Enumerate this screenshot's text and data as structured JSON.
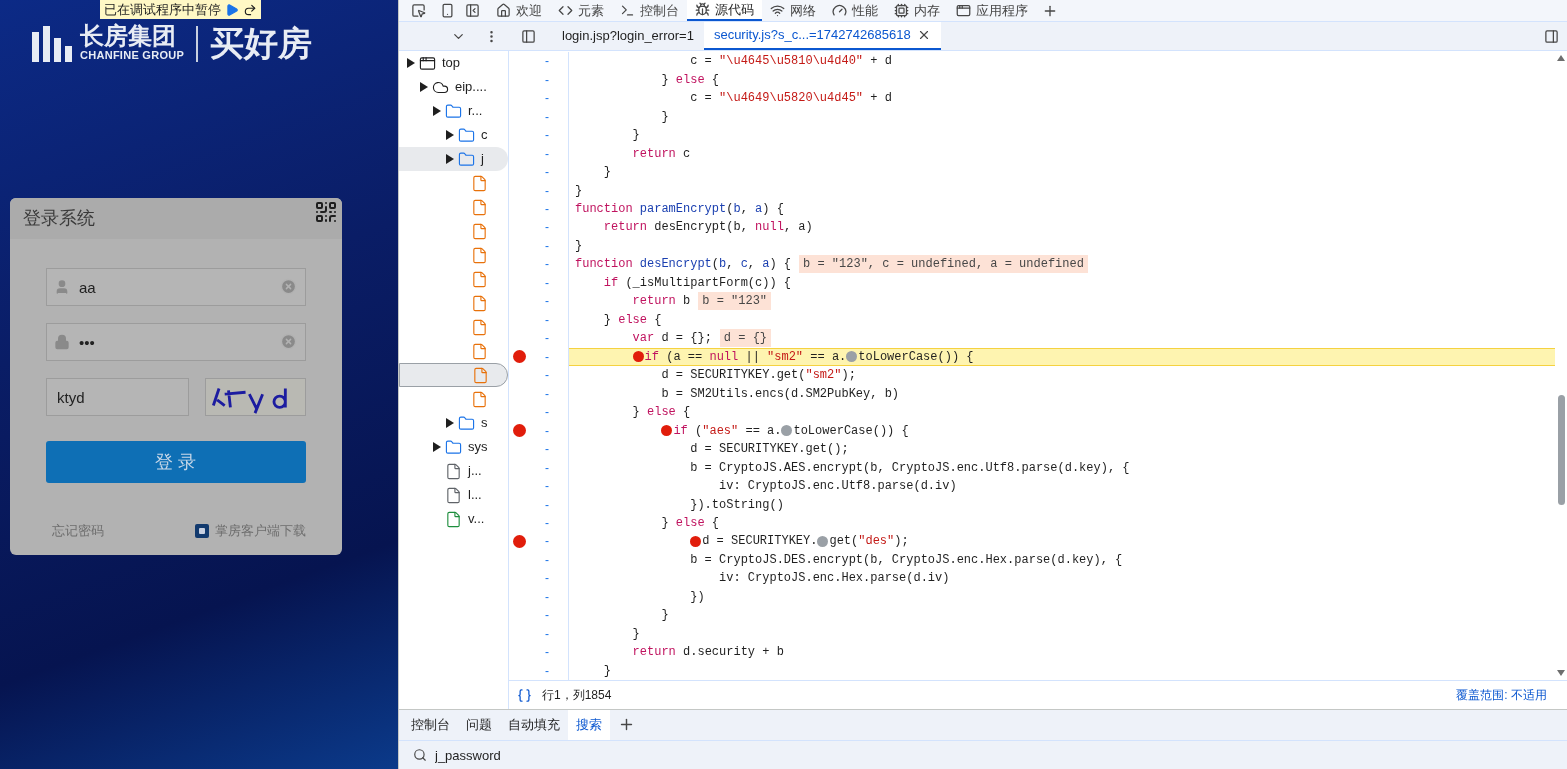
{
  "page": {
    "logo": {
      "name": "长房集团",
      "subtitle": "CHANFINE GROUP",
      "slogan": "买好房"
    },
    "debug_banner": {
      "text": "已在调试程序中暂停"
    },
    "login": {
      "title": "登录系统",
      "username": "aa",
      "password": "•••",
      "captcha": "ktyd",
      "submit": "登 录",
      "links": [
        "忘记密码",
        "掌房客户端下载"
      ]
    }
  },
  "devtools": {
    "tabs": [
      {
        "label": "欢迎",
        "selected": false
      },
      {
        "label": "元素",
        "selected": false
      },
      {
        "label": "控制台",
        "selected": false
      },
      {
        "label": "源代码",
        "selected": true
      },
      {
        "label": "网络",
        "selected": false
      },
      {
        "label": "性能",
        "selected": false
      },
      {
        "label": "内存",
        "selected": false
      },
      {
        "label": "应用程序",
        "selected": false
      }
    ],
    "file_tabs": [
      {
        "label": "login.jsp?login_error=1",
        "selected": false
      },
      {
        "label": "security.js?s_c...=1742742685618",
        "selected": true
      }
    ],
    "tree": [
      {
        "label": "top",
        "kind": "frame",
        "selected": false,
        "children": [
          {
            "label": "eip....",
            "kind": "cloud",
            "selected": false,
            "children": [
              {
                "label": "r...",
                "kind": "folder",
                "selected": false,
                "children": [
                  {
                    "label": "c",
                    "kind": "folder",
                    "selected": false
                  },
                  {
                    "label": "j",
                    "kind": "folder",
                    "selected": true,
                    "children": [
                      {
                        "kind": "file",
                        "color": "#e8710a",
                        "selected": false
                      },
                      {
                        "kind": "file",
                        "color": "#e8710a",
                        "selected": false
                      },
                      {
                        "kind": "file",
                        "color": "#e8710a",
                        "selected": false
                      },
                      {
                        "kind": "file",
                        "color": "#e8710a",
                        "selected": false
                      },
                      {
                        "kind": "file",
                        "color": "#e8710a",
                        "selected": false
                      },
                      {
                        "kind": "file",
                        "color": "#e8710a",
                        "selected": false
                      },
                      {
                        "kind": "file",
                        "color": "#e8710a",
                        "selected": false
                      },
                      {
                        "kind": "file",
                        "color": "#e8710a",
                        "selected": false
                      },
                      {
                        "kind": "file",
                        "color": "#e8710a",
                        "selected": true
                      },
                      {
                        "kind": "file",
                        "color": "#e8710a",
                        "selected": false
                      }
                    ]
                  },
                  {
                    "label": "s",
                    "kind": "folder",
                    "selected": false
                  }
                ]
              },
              {
                "label": "sys",
                "kind": "folder",
                "selected": false
              },
              {
                "label": "j...",
                "kind": "file",
                "color": "#5f6368",
                "selected": false
              },
              {
                "label": "l...",
                "kind": "file",
                "color": "#5f6368",
                "selected": false
              },
              {
                "label": "v...",
                "kind": "file",
                "color": "#1e8e3e",
                "selected": false
              }
            ]
          }
        ]
      }
    ],
    "code": {
      "lines": [
        {
          "number": "-",
          "breakpoint": false,
          "paused": false,
          "tokens": [
            {
              "kind": "plain",
              "text": "                c = "
            },
            {
              "kind": "string",
              "text": "\"\\u4645\\u5810\\u4d40\""
            },
            {
              "kind": "plain",
              "text": " + d"
            }
          ]
        },
        {
          "number": "-",
          "breakpoint": false,
          "paused": false,
          "tokens": [
            {
              "kind": "plain",
              "text": "            } "
            },
            {
              "kind": "keyword",
              "text": "else"
            },
            {
              "kind": "plain",
              "text": " {"
            }
          ]
        },
        {
          "number": "-",
          "breakpoint": false,
          "paused": false,
          "tokens": [
            {
              "kind": "plain",
              "text": "                c = "
            },
            {
              "kind": "string",
              "text": "\"\\u4649\\u5820\\u4d45\""
            },
            {
              "kind": "plain",
              "text": " + d"
            }
          ]
        },
        {
          "number": "-",
          "breakpoint": false,
          "paused": false,
          "tokens": [
            {
              "kind": "plain",
              "text": "            }"
            }
          ]
        },
        {
          "number": "-",
          "breakpoint": false,
          "paused": false,
          "tokens": [
            {
              "kind": "plain",
              "text": "        }"
            }
          ]
        },
        {
          "number": "-",
          "breakpoint": false,
          "paused": false,
          "tokens": [
            {
              "kind": "keyword",
              "text": "        return"
            },
            {
              "kind": "plain",
              "text": " c"
            }
          ]
        },
        {
          "number": "-",
          "breakpoint": false,
          "paused": false,
          "tokens": [
            {
              "kind": "plain",
              "text": "    }"
            }
          ]
        },
        {
          "number": "-",
          "breakpoint": false,
          "paused": false,
          "tokens": [
            {
              "kind": "plain",
              "text": "}"
            }
          ]
        },
        {
          "number": "-",
          "breakpoint": false,
          "paused": false,
          "tokens": [
            {
              "kind": "keyword",
              "text": "function"
            },
            {
              "kind": "def",
              "text": " paramEncrypt"
            },
            {
              "kind": "plain",
              "text": "("
            },
            {
              "kind": "def",
              "text": "b"
            },
            {
              "kind": "plain",
              "text": ", "
            },
            {
              "kind": "def",
              "text": "a"
            },
            {
              "kind": "plain",
              "text": ") {"
            }
          ]
        },
        {
          "number": "-",
          "breakpoint": false,
          "paused": false,
          "tokens": [
            {
              "kind": "keyword",
              "text": "    return"
            },
            {
              "kind": "plain",
              "text": " desEncrypt(b, "
            },
            {
              "kind": "keyword",
              "text": "null"
            },
            {
              "kind": "plain",
              "text": ", a)"
            }
          ]
        },
        {
          "number": "-",
          "breakpoint": false,
          "paused": false,
          "tokens": [
            {
              "kind": "plain",
              "text": "}"
            }
          ]
        },
        {
          "number": "-",
          "breakpoint": false,
          "paused": false,
          "tokens": [
            {
              "kind": "keyword",
              "text": "function"
            },
            {
              "kind": "def",
              "text": " desEncrypt"
            },
            {
              "kind": "plain",
              "text": "("
            },
            {
              "kind": "def",
              "text": "b"
            },
            {
              "kind": "plain",
              "text": ", "
            },
            {
              "kind": "def",
              "text": "c"
            },
            {
              "kind": "plain",
              "text": ", "
            },
            {
              "kind": "def",
              "text": "a"
            },
            {
              "kind": "plain",
              "text": ") {"
            }
          ],
          "inline_value": "b = \"123\", c = undefined, a = undefined"
        },
        {
          "number": "-",
          "breakpoint": false,
          "paused": false,
          "tokens": [
            {
              "kind": "keyword",
              "text": "    if"
            },
            {
              "kind": "plain",
              "text": " (_isMultipartForm(c)) {"
            }
          ]
        },
        {
          "number": "-",
          "breakpoint": false,
          "paused": false,
          "tokens": [
            {
              "kind": "keyword",
              "text": "        return"
            },
            {
              "kind": "plain",
              "text": " b"
            }
          ],
          "inline_value": "b = \"123\""
        },
        {
          "number": "-",
          "breakpoint": false,
          "paused": false,
          "tokens": [
            {
              "kind": "plain",
              "text": "    } "
            },
            {
              "kind": "keyword",
              "text": "else"
            },
            {
              "kind": "plain",
              "text": " {"
            }
          ]
        },
        {
          "number": "-",
          "breakpoint": false,
          "paused": false,
          "tokens": [
            {
              "kind": "keyword",
              "text": "        var"
            },
            {
              "kind": "plain",
              "text": " d = {};"
            }
          ],
          "inline_value": "d = {}"
        },
        {
          "number": "-",
          "breakpoint": true,
          "paused": true,
          "tokens": [
            {
              "kind": "breakpoint_marker"
            },
            {
              "kind": "keyword",
              "text": "        if"
            },
            {
              "kind": "plain",
              "text": " (a == "
            },
            {
              "kind": "keyword",
              "text": "null"
            },
            {
              "kind": "plain",
              "text": " || "
            },
            {
              "kind": "string",
              "text": "\"sm2\""
            },
            {
              "kind": "plain",
              "text": " == a."
            },
            {
              "kind": "step_marker"
            },
            {
              "kind": "plain",
              "text": "toLowerCase()) {"
            }
          ]
        },
        {
          "number": "-",
          "breakpoint": false,
          "paused": false,
          "tokens": [
            {
              "kind": "plain",
              "text": "            d = SECURITYKEY.get("
            },
            {
              "kind": "string",
              "text": "\"sm2\""
            },
            {
              "kind": "plain",
              "text": ");"
            }
          ]
        },
        {
          "number": "-",
          "breakpoint": false,
          "paused": false,
          "tokens": [
            {
              "kind": "plain",
              "text": "            b = SM2Utils.encs(d.SM2PubKey, b)"
            }
          ]
        },
        {
          "number": "-",
          "breakpoint": false,
          "paused": false,
          "tokens": [
            {
              "kind": "plain",
              "text": "        } "
            },
            {
              "kind": "keyword",
              "text": "else"
            },
            {
              "kind": "plain",
              "text": " {"
            }
          ]
        },
        {
          "number": "-",
          "breakpoint": true,
          "paused": false,
          "tokens": [
            {
              "kind": "breakpoint_marker"
            },
            {
              "kind": "keyword",
              "text": "            if"
            },
            {
              "kind": "plain",
              "text": " ("
            },
            {
              "kind": "string",
              "text": "\"aes\""
            },
            {
              "kind": "plain",
              "text": " == a."
            },
            {
              "kind": "step_marker"
            },
            {
              "kind": "plain",
              "text": "toLowerCase()) {"
            }
          ]
        },
        {
          "number": "-",
          "breakpoint": false,
          "paused": false,
          "tokens": [
            {
              "kind": "plain",
              "text": "                d = SECURITYKEY.get();"
            }
          ]
        },
        {
          "number": "-",
          "breakpoint": false,
          "paused": false,
          "tokens": [
            {
              "kind": "plain",
              "text": "                b = CryptoJS.AES.encrypt(b, CryptoJS.enc.Utf8.parse(d.key), {"
            }
          ]
        },
        {
          "number": "-",
          "breakpoint": false,
          "paused": false,
          "tokens": [
            {
              "kind": "plain",
              "text": "                    iv: CryptoJS.enc.Utf8.parse(d.iv)"
            }
          ]
        },
        {
          "number": "-",
          "breakpoint": false,
          "paused": false,
          "tokens": [
            {
              "kind": "plain",
              "text": "                }).toString()"
            }
          ]
        },
        {
          "number": "-",
          "breakpoint": false,
          "paused": false,
          "tokens": [
            {
              "kind": "plain",
              "text": "            } "
            },
            {
              "kind": "keyword",
              "text": "else"
            },
            {
              "kind": "plain",
              "text": " {"
            }
          ]
        },
        {
          "number": "-",
          "breakpoint": true,
          "paused": false,
          "tokens": [
            {
              "kind": "breakpoint_marker"
            },
            {
              "kind": "plain",
              "text": "                d = SECURITYKEY."
            },
            {
              "kind": "step_marker"
            },
            {
              "kind": "plain",
              "text": "get("
            },
            {
              "kind": "string",
              "text": "\"des\""
            },
            {
              "kind": "plain",
              "text": ");"
            }
          ]
        },
        {
          "number": "-",
          "breakpoint": false,
          "paused": false,
          "tokens": [
            {
              "kind": "plain",
              "text": "                b = CryptoJS.DES.encrypt(b, CryptoJS.enc.Hex.parse(d.key), {"
            }
          ]
        },
        {
          "number": "-",
          "breakpoint": false,
          "paused": false,
          "tokens": [
            {
              "kind": "plain",
              "text": "                    iv: CryptoJS.enc.Hex.parse(d.iv)"
            }
          ]
        },
        {
          "number": "-",
          "breakpoint": false,
          "paused": false,
          "tokens": [
            {
              "kind": "plain",
              "text": "                })"
            }
          ]
        },
        {
          "number": "-",
          "breakpoint": false,
          "paused": false,
          "tokens": [
            {
              "kind": "plain",
              "text": "            }"
            }
          ]
        },
        {
          "number": "-",
          "breakpoint": false,
          "paused": false,
          "tokens": [
            {
              "kind": "plain",
              "text": "        }"
            }
          ]
        },
        {
          "number": "-",
          "breakpoint": false,
          "paused": false,
          "tokens": [
            {
              "kind": "keyword",
              "text": "        return"
            },
            {
              "kind": "plain",
              "text": " d.security + b"
            }
          ]
        },
        {
          "number": "-",
          "breakpoint": false,
          "paused": false,
          "tokens": [
            {
              "kind": "plain",
              "text": "    }"
            }
          ]
        }
      ]
    },
    "status": {
      "position": "行1，列1854",
      "coverage": "覆盖范围: 不适用"
    },
    "drawer_tabs": [
      {
        "label": "控制台",
        "selected": false
      },
      {
        "label": "问题",
        "selected": false
      },
      {
        "label": "自动填充",
        "selected": false
      },
      {
        "label": "搜索",
        "selected": true
      }
    ],
    "search": {
      "value": "j_password"
    }
  }
}
